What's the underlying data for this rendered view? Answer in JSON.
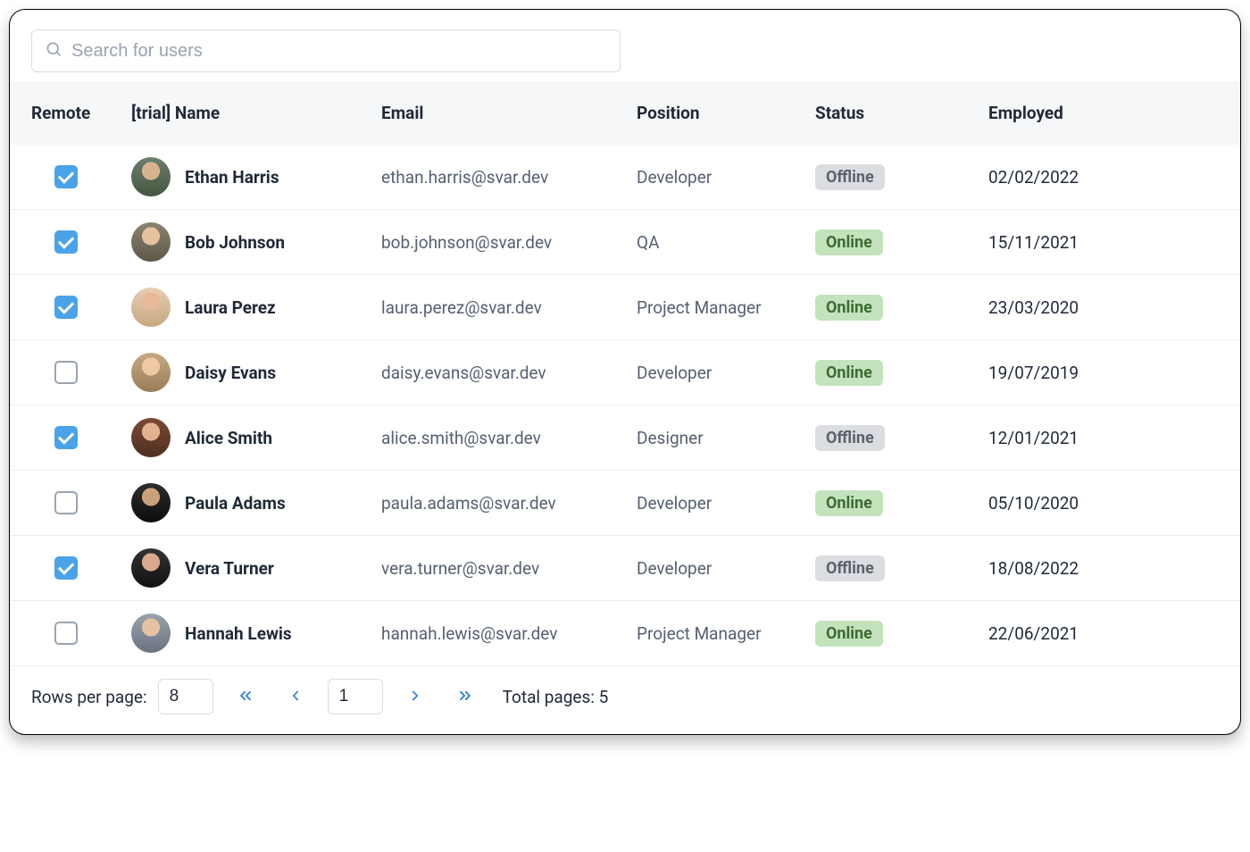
{
  "search": {
    "placeholder": "Search for users"
  },
  "columns": {
    "remote": "Remote",
    "name": "[trial] Name",
    "email": "Email",
    "position": "Position",
    "status": "Status",
    "employed": "Employed"
  },
  "rows": [
    {
      "checked": true,
      "av": "av1",
      "name": "Ethan Harris",
      "email": "ethan.harris@svar.dev",
      "position": "Developer",
      "status": "Offline",
      "employed": "02/02/2022"
    },
    {
      "checked": true,
      "av": "av2",
      "name": "Bob Johnson",
      "email": "bob.johnson@svar.dev",
      "position": "QA",
      "status": "Online",
      "employed": "15/11/2021"
    },
    {
      "checked": true,
      "av": "av3",
      "name": "Laura Perez",
      "email": "laura.perez@svar.dev",
      "position": "Project Manager",
      "status": "Online",
      "employed": "23/03/2020"
    },
    {
      "checked": false,
      "av": "av4",
      "name": "Daisy Evans",
      "email": "daisy.evans@svar.dev",
      "position": "Developer",
      "status": "Online",
      "employed": "19/07/2019"
    },
    {
      "checked": true,
      "av": "av5",
      "name": "Alice Smith",
      "email": "alice.smith@svar.dev",
      "position": "Designer",
      "status": "Offline",
      "employed": "12/01/2021"
    },
    {
      "checked": false,
      "av": "av6",
      "name": "Paula Adams",
      "email": "paula.adams@svar.dev",
      "position": "Developer",
      "status": "Online",
      "employed": "05/10/2020"
    },
    {
      "checked": true,
      "av": "av7",
      "name": "Vera Turner",
      "email": "vera.turner@svar.dev",
      "position": "Developer",
      "status": "Offline",
      "employed": "18/08/2022"
    },
    {
      "checked": false,
      "av": "av8",
      "name": "Hannah Lewis",
      "email": "hannah.lewis@svar.dev",
      "position": "Project Manager",
      "status": "Online",
      "employed": "22/06/2021"
    }
  ],
  "pager": {
    "rows_label": "Rows per page:",
    "rows_per_page": "8",
    "current_page": "1",
    "total_label": "Total pages: 5"
  }
}
